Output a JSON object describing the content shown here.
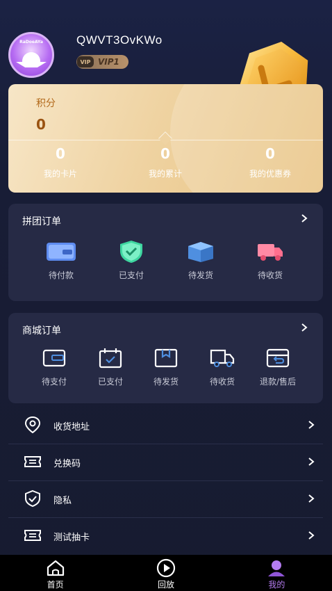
{
  "profile": {
    "username": "QWVT3OvKWo",
    "vip_icon": "VIP",
    "vip_label": "VIP1",
    "avatar_text": "RaDoeAYa"
  },
  "points": {
    "label": "积分",
    "value": "0",
    "stats": [
      {
        "value": "0",
        "label": "我的卡片"
      },
      {
        "value": "0",
        "label": "我的累计"
      },
      {
        "value": "0",
        "label": "我的优惠券"
      }
    ]
  },
  "group_orders": {
    "title": "拼团订单",
    "items": [
      {
        "label": "待付款",
        "icon": "wallet-card-icon"
      },
      {
        "label": "已支付",
        "icon": "shield-check-icon"
      },
      {
        "label": "待发货",
        "icon": "box-icon"
      },
      {
        "label": "待收货",
        "icon": "truck-icon"
      }
    ]
  },
  "mall_orders": {
    "title": "商城订单",
    "items": [
      {
        "label": "待支付",
        "icon": "wallet-outline-icon"
      },
      {
        "label": "已支付",
        "icon": "calendar-check-icon"
      },
      {
        "label": "待发货",
        "icon": "package-outline-icon"
      },
      {
        "label": "待收货",
        "icon": "truck-outline-icon"
      },
      {
        "label": "退款/售后",
        "icon": "return-box-icon"
      }
    ]
  },
  "menu": [
    {
      "label": "收货地址",
      "icon": "location-icon"
    },
    {
      "label": "兑换码",
      "icon": "ticket-icon"
    },
    {
      "label": "隐私",
      "icon": "shield-icon"
    },
    {
      "label": "测试抽卡",
      "icon": "ticket-icon"
    }
  ],
  "tabs": [
    {
      "label": "首页",
      "icon": "home-icon",
      "active": false
    },
    {
      "label": "回放",
      "icon": "play-icon",
      "active": false
    },
    {
      "label": "我的",
      "icon": "user-icon",
      "active": true
    }
  ],
  "colors": {
    "background": "#181d36",
    "card": "#262a45",
    "gold": "#efd3a2",
    "accent_purple": "#b47cf0"
  }
}
